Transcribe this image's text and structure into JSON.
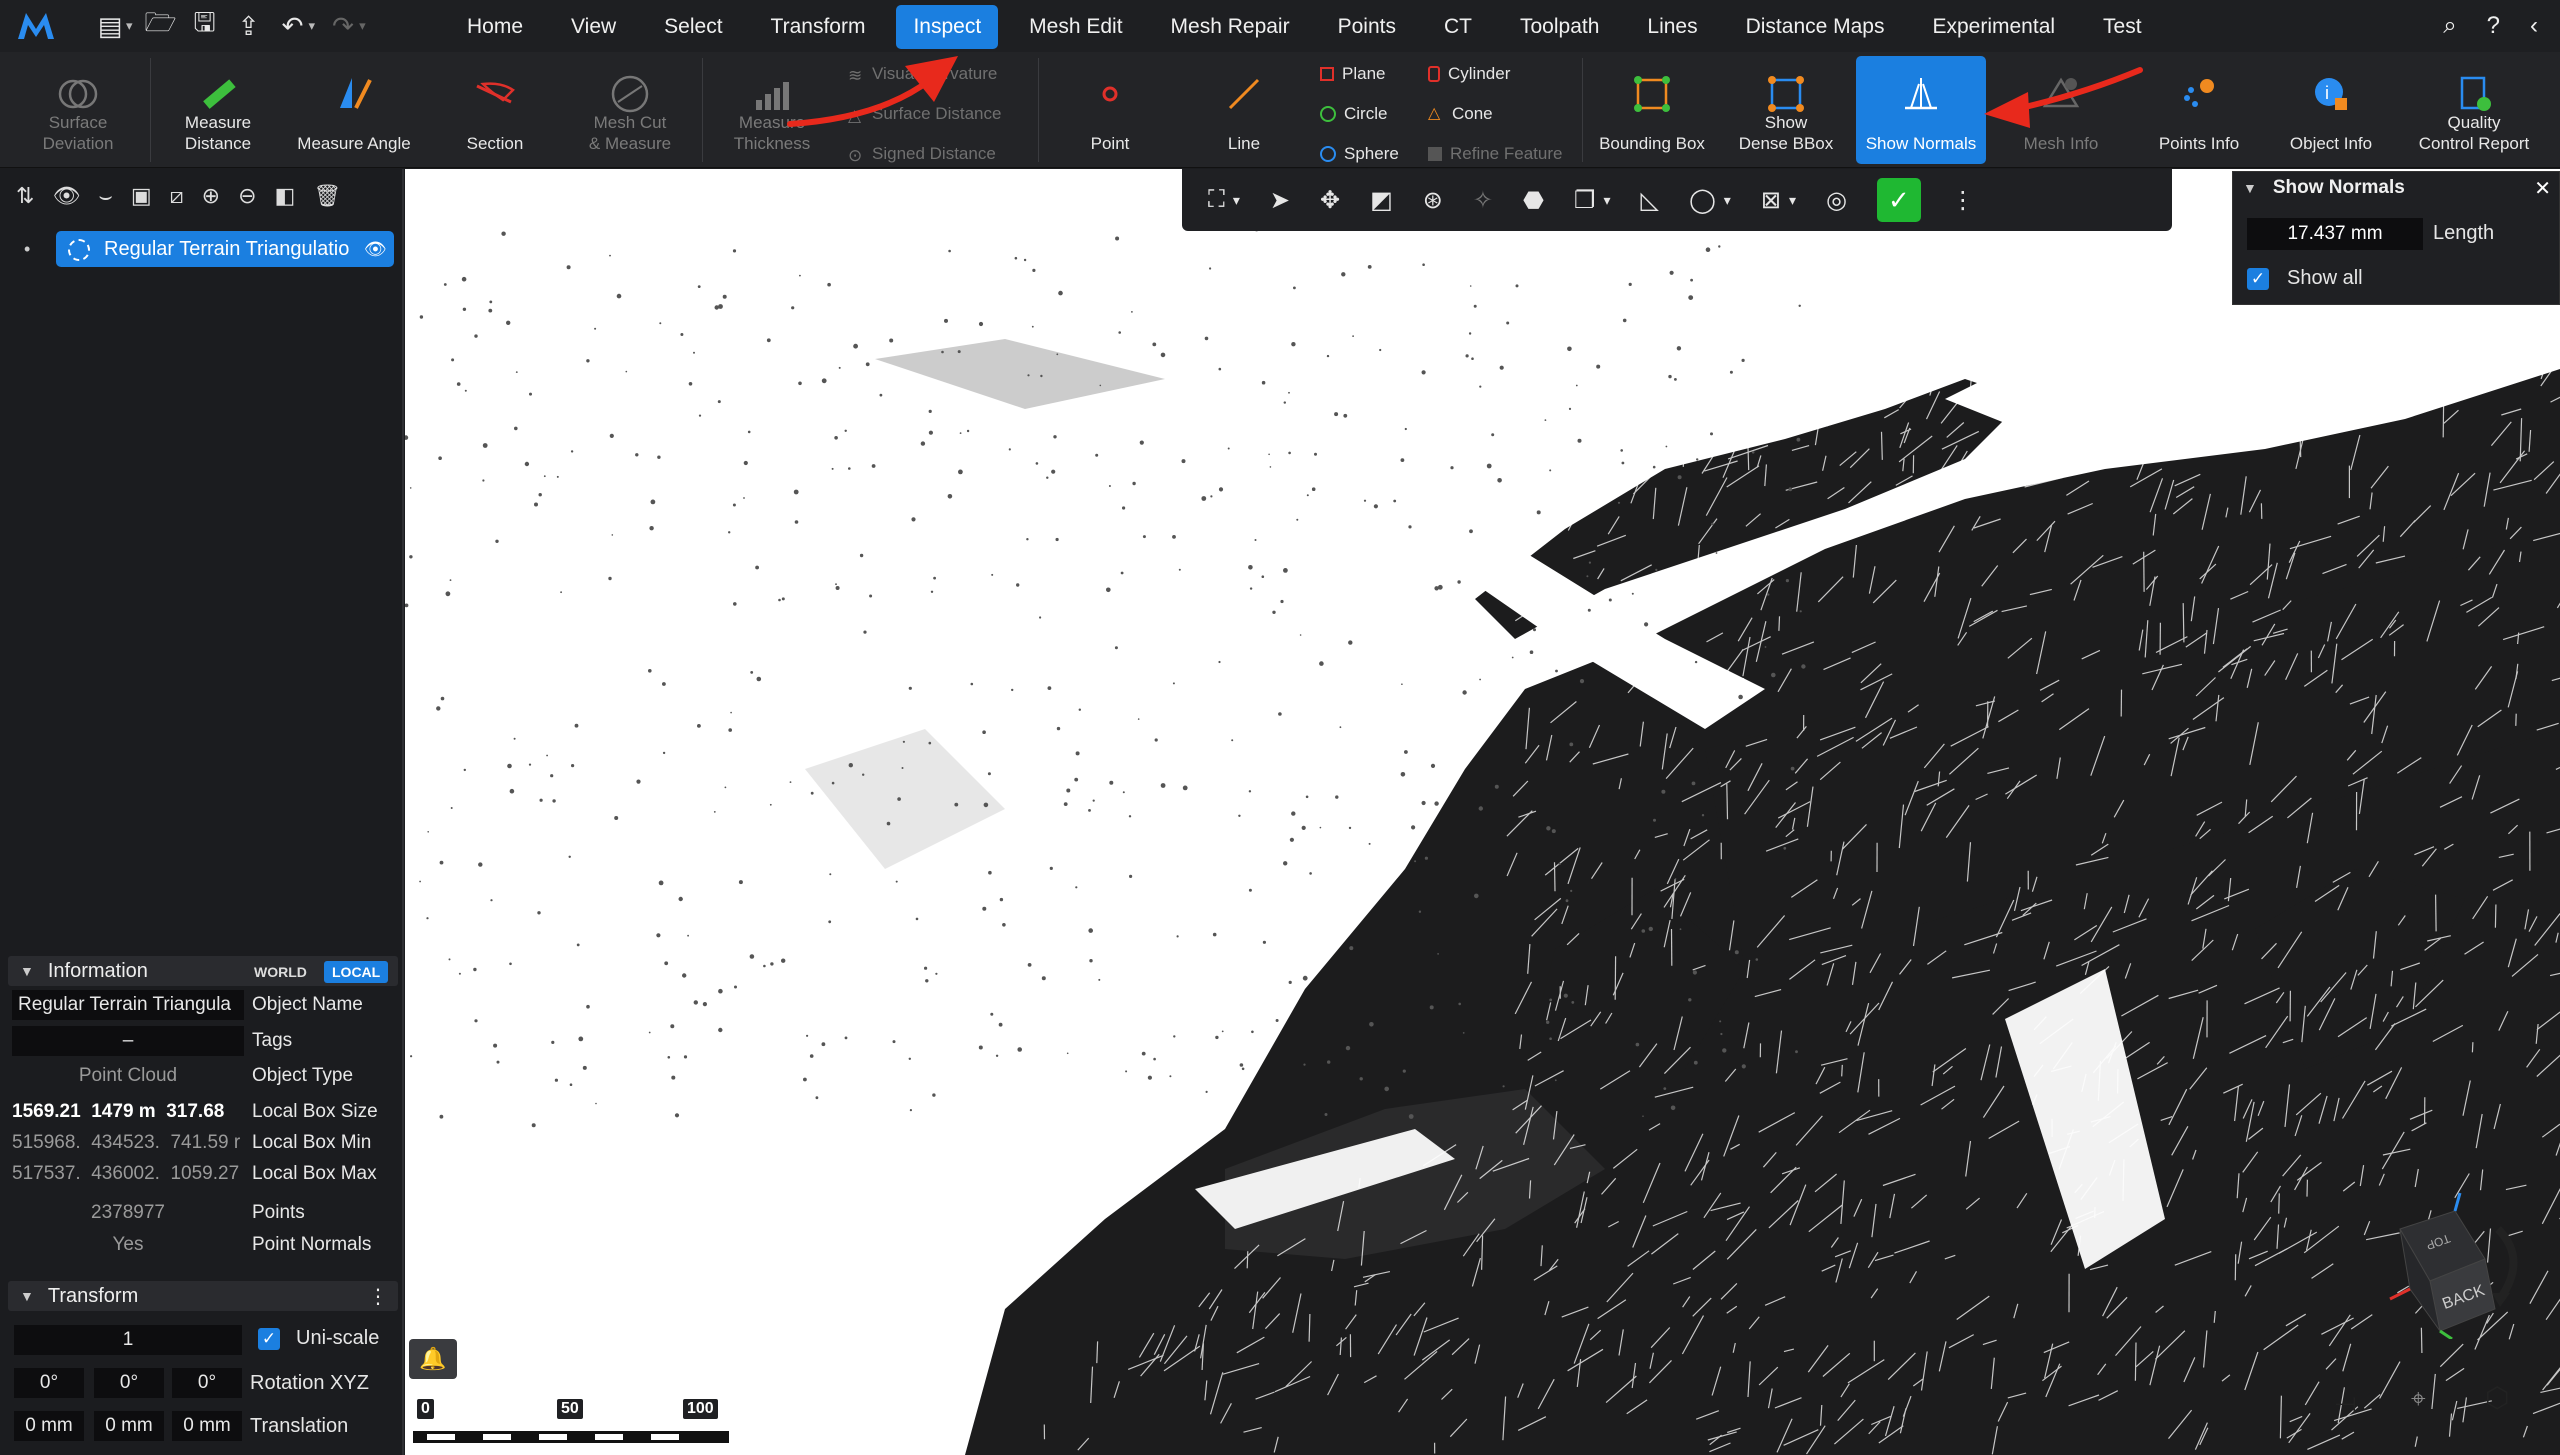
{
  "menubar": {
    "tabs": [
      "Home",
      "View",
      "Select",
      "Transform",
      "Inspect",
      "Mesh Edit",
      "Mesh Repair",
      "Points",
      "CT",
      "Toolpath",
      "Lines",
      "Distance Maps",
      "Experimental",
      "Test"
    ],
    "active_tab": "Inspect"
  },
  "ribbon": {
    "surface_deviation": "Surface\nDeviation",
    "measure_distance": "Measure\nDistance",
    "measure_angle": "Measure Angle",
    "section": "Section",
    "mesh_cut": "Mesh Cut\n& Measure",
    "measure_thickness": "Measure\nThickness",
    "visual_curvature": "Visual Curvature",
    "surface_distance": "Surface Distance",
    "signed_distance": "Signed Distance",
    "point": "Point",
    "line": "Line",
    "plane": "Plane",
    "circle": "Circle",
    "sphere": "Sphere",
    "cylinder": "Cylinder",
    "cone": "Cone",
    "refine_feature": "Refine Feature",
    "bounding_box": "Bounding Box",
    "show_dense_bbox": "Show\nDense BBox",
    "show_normals": "Show Normals",
    "mesh_info": "Mesh Info",
    "points_info": "Points Info",
    "object_info": "Object Info",
    "quality_report": "Quality\nControl Report"
  },
  "tree": {
    "item_label": "Regular Terrain Triangulatio"
  },
  "information": {
    "title": "Information",
    "world": "WORLD",
    "local": "LOCAL",
    "object_name_value": "Regular Terrain Triangula",
    "object_name_label": "Object Name",
    "tags_value": "–",
    "tags_label": "Tags",
    "object_type_value": "Point Cloud",
    "object_type_label": "Object Type",
    "local_box_size_value": "1569.21  1479 m  317.68",
    "local_box_size_label": "Local Box Size",
    "local_box_min_value": "515968.  434523.  741.59 r",
    "local_box_min_label": "Local Box Min",
    "local_box_max_value": "517537.  436002.  1059.27",
    "local_box_max_label": "Local Box Max",
    "points_value": "2378977",
    "points_label": "Points",
    "normals_value": "Yes",
    "normals_label": "Point Normals"
  },
  "transform": {
    "title": "Transform",
    "scale": "1",
    "uniscale_label": "Uni-scale",
    "rot_x": "0°",
    "rot_y": "0°",
    "rot_z": "0°",
    "rotation_label": "Rotation XYZ",
    "tr_x": "0 mm",
    "tr_y": "0 mm",
    "tr_z": "0 mm",
    "translation_label": "Translation"
  },
  "normals_panel": {
    "title": "Show Normals",
    "length_value": "17.437 mm",
    "length_label": "Length",
    "show_all_label": "Show all"
  },
  "scale_bar": {
    "labels": [
      "0",
      "50",
      "100"
    ]
  },
  "view_cube": {
    "top": "TOP",
    "back": "BACK"
  },
  "colors": {
    "accent": "#1b7fe0",
    "annotation_arrow": "#e8291c",
    "ok_green": "#1fb832"
  }
}
